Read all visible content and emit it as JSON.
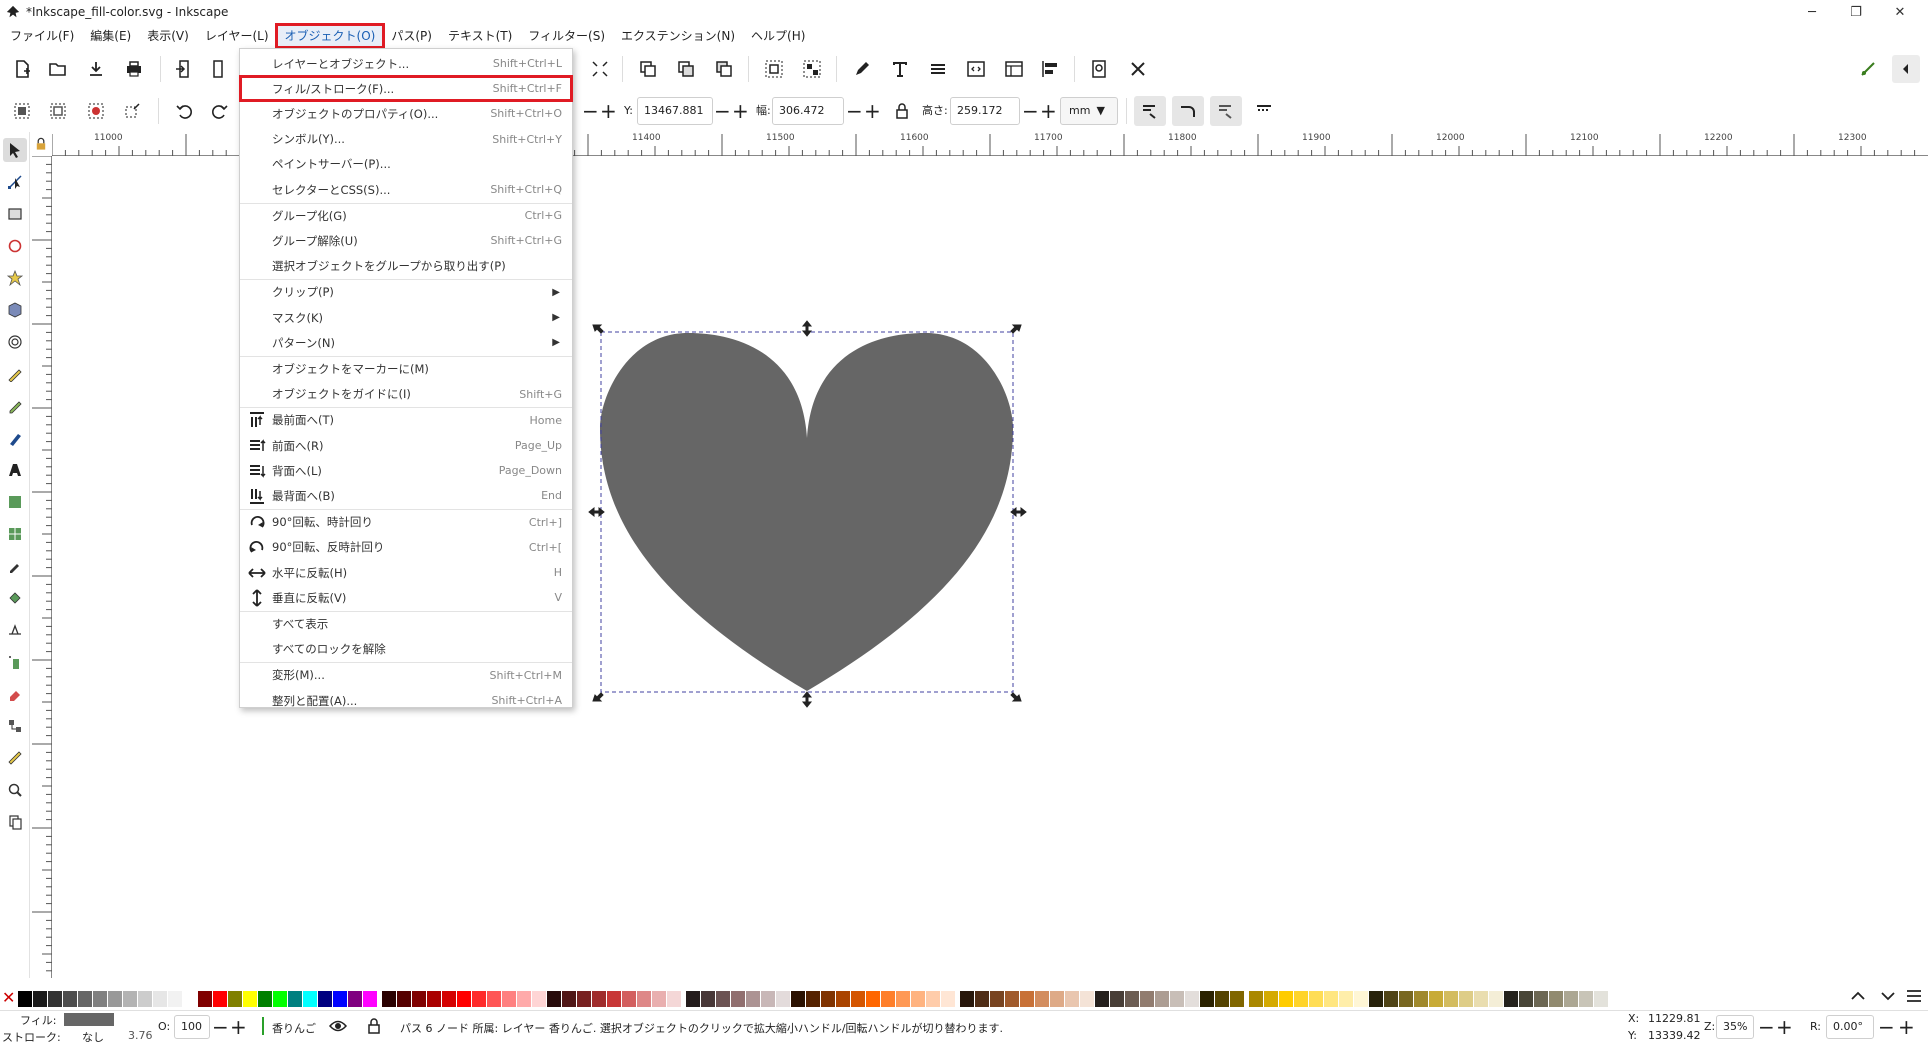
{
  "window": {
    "title": "*Inkscape_fill-color.svg - Inkscape",
    "controls": [
      "minimize",
      "restore",
      "close"
    ],
    "control_glyphs": [
      "─",
      "❐",
      "✕"
    ]
  },
  "menubar": {
    "items": [
      "ファイル(F)",
      "編集(E)",
      "表示(V)",
      "レイヤー(L)",
      "オブジェクト(O)",
      "パス(P)",
      "テキスト(T)",
      "フィルター(S)",
      "エクステンション(N)",
      "ヘルプ(H)"
    ],
    "active_index": 4
  },
  "toolctrl": {
    "y_label": "Y:",
    "y_value": "13467.881",
    "w_label": "幅:",
    "w_value": "306.472",
    "h_label": "高さ:",
    "h_value": "259.172",
    "unit": "mm"
  },
  "ruler": {
    "labels": [
      "11000",
      "11400",
      "11500",
      "11600",
      "11700",
      "11800",
      "11900",
      "12000",
      "12100",
      "12200",
      "12300"
    ]
  },
  "object_menu": {
    "items": [
      {
        "label": "レイヤーとオブジェクト...",
        "shortcut": "Shift+Ctrl+L",
        "icon": ""
      },
      {
        "label": "フィル/ストローク(F)...",
        "shortcut": "Shift+Ctrl+F",
        "icon": "",
        "highlight": true
      },
      {
        "label": "オブジェクトのプロパティ(O)...",
        "shortcut": "Shift+Ctrl+O",
        "icon": ""
      },
      {
        "label": "シンボル(Y)...",
        "shortcut": "Shift+Ctrl+Y",
        "icon": ""
      },
      {
        "label": "ペイントサーバー(P)...",
        "shortcut": "",
        "icon": ""
      },
      {
        "label": "セレクターとCSS(S)...",
        "shortcut": "Shift+Ctrl+Q",
        "icon": ""
      },
      {
        "sep": true
      },
      {
        "label": "グループ化(G)",
        "shortcut": "Ctrl+G",
        "icon": ""
      },
      {
        "label": "グループ解除(U)",
        "shortcut": "Shift+Ctrl+G",
        "icon": ""
      },
      {
        "label": "選択オブジェクトをグループから取り出す(P)",
        "shortcut": "",
        "icon": ""
      },
      {
        "sep": true
      },
      {
        "label": "クリップ(P)",
        "shortcut": "",
        "submenu": true,
        "icon": ""
      },
      {
        "label": "マスク(K)",
        "shortcut": "",
        "submenu": true,
        "icon": ""
      },
      {
        "label": "パターン(N)",
        "shortcut": "",
        "submenu": true,
        "icon": ""
      },
      {
        "sep": true
      },
      {
        "label": "オブジェクトをマーカーに(M)",
        "shortcut": "",
        "icon": ""
      },
      {
        "label": "オブジェクトをガイドに(I)",
        "shortcut": "Shift+G",
        "icon": ""
      },
      {
        "sep": true
      },
      {
        "label": "最前面へ(T)",
        "shortcut": "Home",
        "icon": "raise-top-icon"
      },
      {
        "label": "前面へ(R)",
        "shortcut": "Page_Up",
        "icon": "raise-icon"
      },
      {
        "label": "背面へ(L)",
        "shortcut": "Page_Down",
        "icon": "lower-icon"
      },
      {
        "label": "最背面へ(B)",
        "shortcut": "End",
        "icon": "lower-bottom-icon"
      },
      {
        "sep": true
      },
      {
        "label": "90°回転、時計回り",
        "shortcut": "Ctrl+]",
        "icon": "rotate-cw-icon"
      },
      {
        "label": "90°回転、反時計回り",
        "shortcut": "Ctrl+[",
        "icon": "rotate-ccw-icon"
      },
      {
        "label": "水平に反転(H)",
        "shortcut": "H",
        "icon": "flip-horizontal-icon"
      },
      {
        "label": "垂直に反転(V)",
        "shortcut": "V",
        "icon": "flip-vertical-icon"
      },
      {
        "sep": true
      },
      {
        "label": "すべて表示",
        "shortcut": "",
        "icon": ""
      },
      {
        "label": "すべてのロックを解除",
        "shortcut": "",
        "icon": ""
      },
      {
        "sep": true
      },
      {
        "label": "変形(M)...",
        "shortcut": "Shift+Ctrl+M",
        "icon": ""
      },
      {
        "label": "整列と配置(A)...",
        "shortcut": "Shift+Ctrl+A",
        "icon": ""
      }
    ]
  },
  "shape": {
    "type": "heart",
    "fill": "#666666"
  },
  "palette": {
    "none_glyph": "✕",
    "colors": [
      "#000000",
      "#1a1a1a",
      "#333333",
      "#4d4d4d",
      "#666666",
      "#808080",
      "#999999",
      "#b3b3b3",
      "#cccccc",
      "#e6e6e6",
      "#f2f2f2",
      "#ffffff",
      "#800000",
      "#ff0000",
      "#808000",
      "#ffff00",
      "#008000",
      "#00ff00",
      "#008080",
      "#00ffff",
      "#000080",
      "#0000ff",
      "#800080",
      "#ff00ff",
      "#2b0000",
      "#550000",
      "#800000",
      "#aa0000",
      "#d40000",
      "#ff0000",
      "#ff2a2a",
      "#ff5555",
      "#ff8080",
      "#ffaaaa",
      "#ffd5d5",
      "#280b0b",
      "#501616",
      "#782121",
      "#a02c2c",
      "#c83737",
      "#d35f5f",
      "#de8787",
      "#e9afaf",
      "#f4d7d7",
      "#241c1c",
      "#483737",
      "#6c5353",
      "#916f6f",
      "#ac9393",
      "#c8b7b7",
      "#e3dbdb",
      "#2b1100",
      "#552200",
      "#803300",
      "#aa4400",
      "#d45500",
      "#ff6600",
      "#ff7f2a",
      "#ff9955",
      "#ffb380",
      "#ffccaa",
      "#ffe6d5",
      "#28170b",
      "#502d16",
      "#784421",
      "#a05a2c",
      "#c87137",
      "#d38d5f",
      "#deaa87",
      "#e9c6af",
      "#f4e3d7",
      "#241f1c",
      "#483e37",
      "#6c5d53",
      "#917c6f",
      "#ac9d93",
      "#c8beb7",
      "#e3dedb",
      "#2b2200",
      "#554400",
      "#806600",
      "#aa8800",
      "#d4aa00",
      "#ffcc00",
      "#ffd42a",
      "#ffdd55",
      "#ffe680",
      "#ffeeaa",
      "#fff6d5",
      "#28220b",
      "#504416",
      "#786721",
      "#a0892c",
      "#c8ab37",
      "#d3bc5f",
      "#decd87",
      "#e9ddaf",
      "#f4eed7",
      "#24221c",
      "#484537",
      "#6c6753",
      "#918a6f",
      "#aca793",
      "#c8c4b7",
      "#e3e2db"
    ]
  },
  "status": {
    "fill_label": "フィル:",
    "stroke_label": "ストローク:",
    "stroke_value": "なし",
    "stroke_width": "3.76",
    "fill_color": "#666666",
    "opacity_label": "O:",
    "opacity_value": "100",
    "layer_name": "香りんご",
    "message": "パス 6 ノード 所属: レイヤー 香りんご. 選択オブジェクトのクリックで拡大縮小ハンドル/回転ハンドルが切り替わります.",
    "x_label": "X:",
    "x_value": "11229.81",
    "y_label": "Y:",
    "y_value": "13339.42",
    "zoom_label": "Z:",
    "zoom_value": "35%",
    "rotate_label": "R:",
    "rotate_value": "0.00°"
  }
}
